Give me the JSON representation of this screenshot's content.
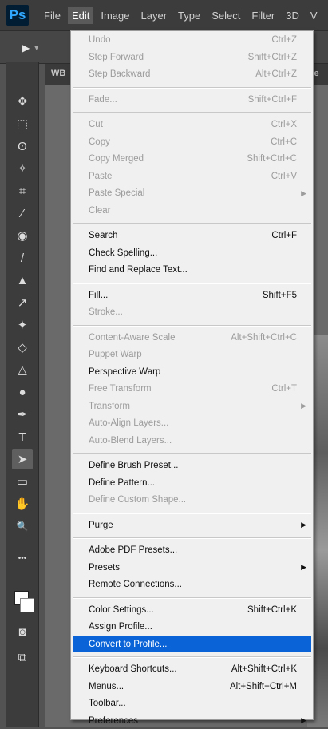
{
  "app": {
    "logo_text": "Ps"
  },
  "menubar": {
    "items": [
      {
        "label": "File"
      },
      {
        "label": "Edit",
        "active": true
      },
      {
        "label": "Image"
      },
      {
        "label": "Layer"
      },
      {
        "label": "Type"
      },
      {
        "label": "Select"
      },
      {
        "label": "Filter"
      },
      {
        "label": "3D"
      },
      {
        "label": "V"
      }
    ]
  },
  "optionsbar": {
    "tool_glyph": "▶",
    "dropdown_glyph": "▾"
  },
  "document": {
    "tab_left": "WB",
    "tab_right": "Ge"
  },
  "toolbar": {
    "tools": [
      {
        "name": "move-tool-icon",
        "glyph": "✥"
      },
      {
        "name": "marquee-tool-icon",
        "glyph": "⬚"
      },
      {
        "name": "lasso-tool-icon",
        "glyph": "ʘ"
      },
      {
        "name": "magic-wand-tool-icon",
        "glyph": "✧"
      },
      {
        "name": "crop-tool-icon",
        "glyph": "⌗"
      },
      {
        "name": "eyedropper-tool-icon",
        "glyph": "⁄"
      },
      {
        "name": "healing-brush-tool-icon",
        "glyph": "◉"
      },
      {
        "name": "brush-tool-icon",
        "glyph": "/"
      },
      {
        "name": "stamp-tool-icon",
        "glyph": "▲"
      },
      {
        "name": "history-brush-tool-icon",
        "glyph": "↗"
      },
      {
        "name": "eraser-tool-icon",
        "glyph": "✦"
      },
      {
        "name": "paint-bucket-tool-icon",
        "glyph": "◇"
      },
      {
        "name": "blur-tool-icon",
        "glyph": "△"
      },
      {
        "name": "dodge-tool-icon",
        "glyph": "●"
      },
      {
        "name": "pen-tool-icon",
        "glyph": "✒"
      },
      {
        "name": "type-tool-icon",
        "glyph": "T"
      },
      {
        "name": "path-selection-tool-icon",
        "glyph": "➤",
        "selected": true
      },
      {
        "name": "rectangle-tool-icon",
        "glyph": "▭"
      },
      {
        "name": "hand-tool-icon",
        "glyph": "✋"
      },
      {
        "name": "zoom-tool-icon",
        "glyph": "🔍"
      },
      {
        "name": "more-tools-icon",
        "glyph": "•••"
      },
      {
        "name": "quick-mask-icon",
        "glyph": "◙"
      },
      {
        "name": "screen-mode-icon",
        "glyph": "⧉"
      }
    ]
  },
  "edit_menu": {
    "items": [
      {
        "label": "Undo",
        "shortcut": "Ctrl+Z",
        "disabled": true
      },
      {
        "label": "Step Forward",
        "shortcut": "Shift+Ctrl+Z",
        "disabled": true
      },
      {
        "label": "Step Backward",
        "shortcut": "Alt+Ctrl+Z",
        "disabled": true
      },
      {
        "sep": true
      },
      {
        "label": "Fade...",
        "shortcut": "Shift+Ctrl+F",
        "disabled": true
      },
      {
        "sep": true
      },
      {
        "label": "Cut",
        "shortcut": "Ctrl+X",
        "disabled": true
      },
      {
        "label": "Copy",
        "shortcut": "Ctrl+C",
        "disabled": true
      },
      {
        "label": "Copy Merged",
        "shortcut": "Shift+Ctrl+C",
        "disabled": true
      },
      {
        "label": "Paste",
        "shortcut": "Ctrl+V",
        "disabled": true
      },
      {
        "label": "Paste Special",
        "submenu": true,
        "disabled": true
      },
      {
        "label": "Clear",
        "disabled": true
      },
      {
        "sep": true
      },
      {
        "label": "Search",
        "shortcut": "Ctrl+F"
      },
      {
        "label": "Check Spelling..."
      },
      {
        "label": "Find and Replace Text..."
      },
      {
        "sep": true
      },
      {
        "label": "Fill...",
        "shortcut": "Shift+F5"
      },
      {
        "label": "Stroke...",
        "disabled": true
      },
      {
        "sep": true
      },
      {
        "label": "Content-Aware Scale",
        "shortcut": "Alt+Shift+Ctrl+C",
        "disabled": true
      },
      {
        "label": "Puppet Warp",
        "disabled": true
      },
      {
        "label": "Perspective Warp"
      },
      {
        "label": "Free Transform",
        "shortcut": "Ctrl+T",
        "disabled": true
      },
      {
        "label": "Transform",
        "submenu": true,
        "disabled": true
      },
      {
        "label": "Auto-Align Layers...",
        "disabled": true
      },
      {
        "label": "Auto-Blend Layers...",
        "disabled": true
      },
      {
        "sep": true
      },
      {
        "label": "Define Brush Preset..."
      },
      {
        "label": "Define Pattern..."
      },
      {
        "label": "Define Custom Shape...",
        "disabled": true
      },
      {
        "sep": true
      },
      {
        "label": "Purge",
        "submenu": true
      },
      {
        "sep": true
      },
      {
        "label": "Adobe PDF Presets..."
      },
      {
        "label": "Presets",
        "submenu": true
      },
      {
        "label": "Remote Connections..."
      },
      {
        "sep": true
      },
      {
        "label": "Color Settings...",
        "shortcut": "Shift+Ctrl+K"
      },
      {
        "label": "Assign Profile..."
      },
      {
        "label": "Convert to Profile...",
        "highlighted": true
      },
      {
        "sep": true
      },
      {
        "label": "Keyboard Shortcuts...",
        "shortcut": "Alt+Shift+Ctrl+K"
      },
      {
        "label": "Menus...",
        "shortcut": "Alt+Shift+Ctrl+M"
      },
      {
        "label": "Toolbar..."
      },
      {
        "label": "Preferences",
        "submenu": true
      }
    ]
  }
}
